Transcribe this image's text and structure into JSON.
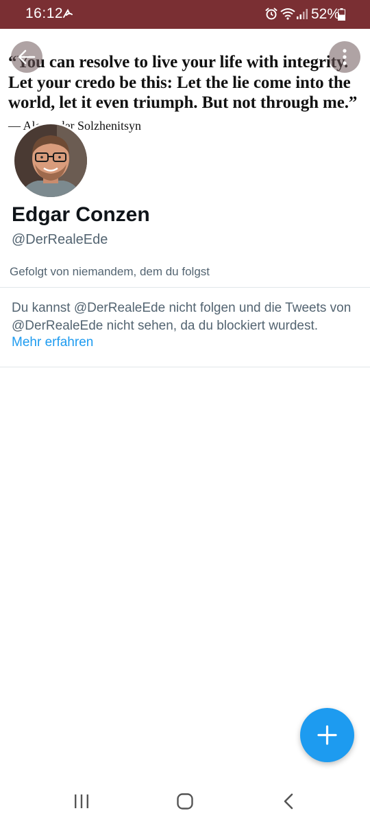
{
  "status_bar": {
    "time": "16:12",
    "battery": "52%",
    "background_color": "#7a2f33"
  },
  "banner": {
    "quote": "“You can resolve to live your life with integrity. Let your credo be this: Let the lie come into the world, let it even triumph. But not through me.”",
    "author": "— Alexander Solzhenitsyn"
  },
  "profile": {
    "display_name": "Edgar Conzen",
    "handle": "@DerRealeEde",
    "followed_by": "Gefolgt von niemandem, dem du folgst"
  },
  "blocked_notice": {
    "text": "Du kannst @DerRealeEde nicht folgen und die Tweets von @DerRealeEde nicht sehen, da du blockiert wurdest.",
    "link": "Mehr erfahren"
  },
  "icons": {
    "back": "arrow-left-icon",
    "more": "more-vertical-icon",
    "fab": "plus-icon",
    "nav_recents": "recents-icon",
    "nav_home": "home-icon",
    "nav_back": "chevron-left-icon"
  },
  "colors": {
    "accent": "#1d9bf0",
    "secondary_text": "#536471",
    "primary_text": "#0f1419"
  }
}
